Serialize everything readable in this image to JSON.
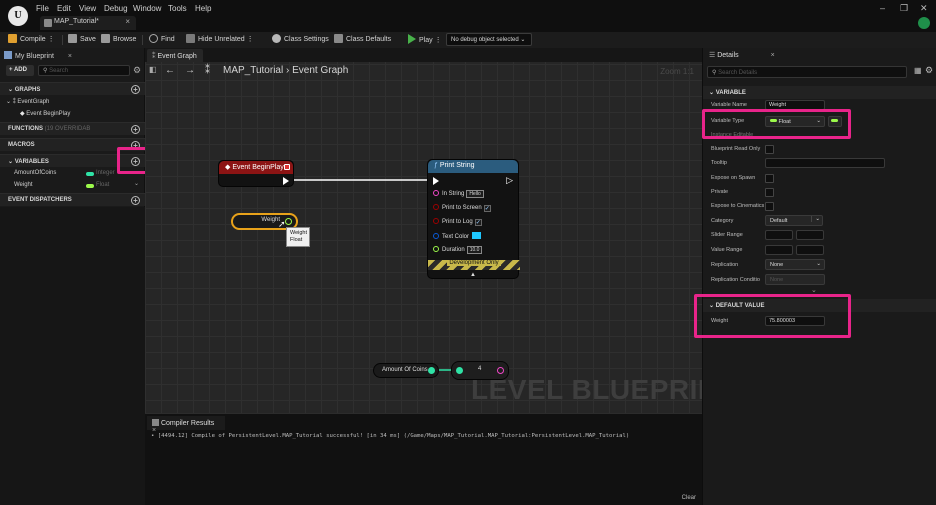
{
  "app": {
    "logo": "U",
    "menu": [
      "File",
      "Edit",
      "View",
      "Debug",
      "Window",
      "Tools",
      "Help"
    ],
    "document_tab": "MAP_Tutorial*",
    "window_controls": [
      "–",
      "❐",
      "✕"
    ]
  },
  "toolbar": {
    "compile": "Compile",
    "save": "Save",
    "browse": "Browse",
    "find": "Find",
    "hide_unrelated": "Hide Unrelated",
    "class_settings": "Class Settings",
    "class_defaults": "Class Defaults",
    "play": "Play",
    "debug_object": "No debug object selected"
  },
  "my_blueprint": {
    "tab": "My Blueprint",
    "add": "+ ADD",
    "search_placeholder": "Search",
    "sections": {
      "graphs": "GRAPHS",
      "functions": "FUNCTIONS",
      "functions_count": "(19 OVERRIDAB",
      "macros": "MACROS",
      "variables": "VARIABLES",
      "event_dispatchers": "EVENT DISPATCHERS"
    },
    "graph_items": [
      "EventGraph",
      "Event BeginPlay"
    ],
    "variables": [
      {
        "name": "AmountOfCoins",
        "type": "Integer",
        "color": "#2fe3a6"
      },
      {
        "name": "Weight",
        "type": "Float",
        "color": "#9cf94b"
      }
    ]
  },
  "graph": {
    "tab": "Event Graph",
    "breadcrumb_root": "MAP_Tutorial",
    "breadcrumb_sep": "›",
    "breadcrumb_leaf": "Event Graph",
    "zoom": "Zoom 1:1",
    "watermark": "LEVEL BLUEPRINT",
    "event_node": "Event BeginPlay",
    "print_node": {
      "title": "Print String",
      "in_string": "In String",
      "in_string_value": "Hello",
      "print_screen": "Print to Screen",
      "print_log": "Print to Log",
      "text_color": "Text Color",
      "duration": "Duration",
      "duration_value": "10.0",
      "dev_only": "Development Only"
    },
    "weight_node": "Weight",
    "tooltip": {
      "line1": "Weight",
      "line2": "Float"
    },
    "coins_node": "Amount Of Coins",
    "convert_node": "4"
  },
  "compiler": {
    "tab": "Compiler Results",
    "message": "• [4494.12] Compile of PersistentLevel.MAP_Tutorial successful! [in 34 ms] (/Game/Maps/MAP_Tutorial.MAP_Tutorial:PersistentLevel.MAP_Tutorial)",
    "clear": "Clear"
  },
  "details": {
    "tab": "Details",
    "search_placeholder": "Search Details",
    "variable_section": "VARIABLE",
    "variable_name_label": "Variable Name",
    "variable_name": "Weight",
    "variable_type_label": "Variable Type",
    "variable_type": "Float",
    "instance_editable": "Instance Editable",
    "blueprint_read_only": "Blueprint Read Only",
    "tooltip_label": "Tooltip",
    "expose_spawn": "Expose on Spawn",
    "private": "Private",
    "expose_cinematics": "Expose to Cinematics",
    "category_label": "Category",
    "category_value": "Default",
    "slider_range": "Slider Range",
    "value_range": "Value Range",
    "replication_label": "Replication",
    "replication_value": "None",
    "replication_condition": "Replication Conditio",
    "replication_condition_value": "None",
    "default_section": "DEFAULT VALUE",
    "default_label": "Weight",
    "default_value": "75.800003"
  },
  "colors": {
    "highlight": "#e8248a",
    "event_header": "#8c1414",
    "function_header": "#2b5c7e",
    "float_pin": "#9cf94b",
    "integer_pin": "#2fe3a6",
    "string_pin": "#f047c8",
    "bool_pin": "#9e0000"
  }
}
